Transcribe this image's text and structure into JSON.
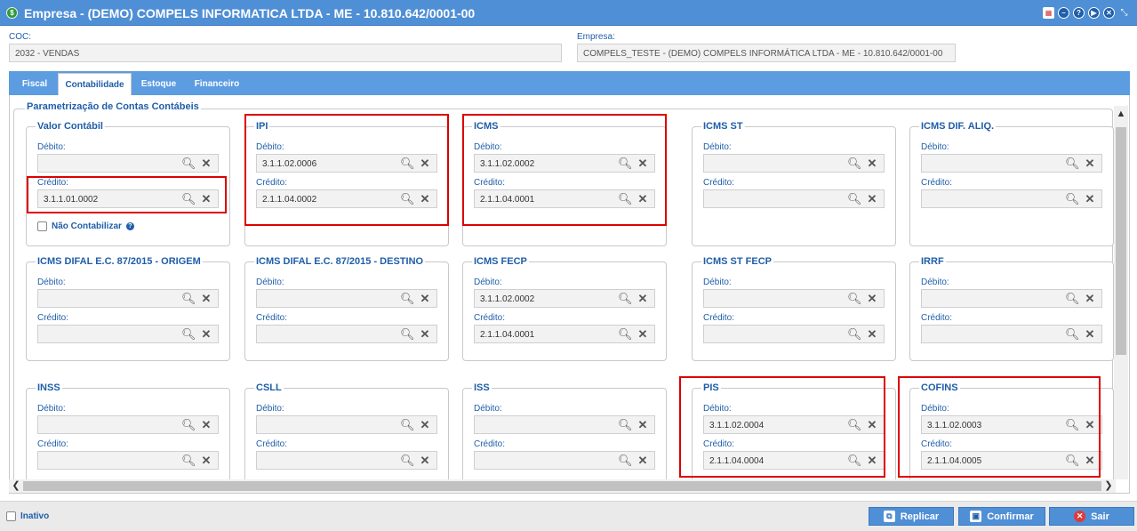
{
  "window": {
    "title": "Empresa - (DEMO) COMPELS INFORMATICA LTDA - ME - 10.810.642/0001-00",
    "icons": [
      "calendar-icon",
      "minimize-icon",
      "help-icon",
      "play-icon",
      "close-icon",
      "resize-icon"
    ]
  },
  "header": {
    "coc_label": "COC:",
    "coc_value": "2032 - VENDAS",
    "empresa_label": "Empresa:",
    "empresa_value": "COMPELS_TESTE - (DEMO) COMPELS INFORMÁTICA LTDA - ME - 10.810.642/0001-00"
  },
  "tabs": [
    {
      "label": "Fiscal"
    },
    {
      "label": "Contabilidade"
    },
    {
      "label": "Estoque"
    },
    {
      "label": "Financeiro"
    }
  ],
  "section": {
    "title": "Parametrização de Contas Contábeis",
    "debit_label": "Débito:",
    "credit_label": "Crédito:",
    "nao_contabilizar": "Não Contabilizar",
    "groups": [
      {
        "title": "Valor Contábil",
        "debito": "",
        "credito": "3.1.1.01.0002"
      },
      {
        "title": "IPI",
        "debito": "3.1.1.02.0006",
        "credito": "2.1.1.04.0002"
      },
      {
        "title": "ICMS",
        "debito": "3.1.1.02.0002",
        "credito": "2.1.1.04.0001"
      },
      {
        "title": "ICMS ST",
        "debito": "",
        "credito": ""
      },
      {
        "title": "ICMS DIF. ALIQ.",
        "debito": "",
        "credito": ""
      },
      {
        "title": "ICMS DIFAL E.C. 87/2015 - ORIGEM",
        "debito": "",
        "credito": ""
      },
      {
        "title": "ICMS DIFAL E.C. 87/2015 - DESTINO",
        "debito": "",
        "credito": ""
      },
      {
        "title": "ICMS FECP",
        "debito": "3.1.1.02.0002",
        "credito": "2.1.1.04.0001"
      },
      {
        "title": "ICMS ST FECP",
        "debito": "",
        "credito": ""
      },
      {
        "title": "IRRF",
        "debito": "",
        "credito": ""
      },
      {
        "title": "INSS",
        "debito": "",
        "credito": ""
      },
      {
        "title": "CSLL",
        "debito": "",
        "credito": ""
      },
      {
        "title": "ISS",
        "debito": "",
        "credito": ""
      },
      {
        "title": "PIS",
        "debito": "3.1.1.02.0004",
        "credito": "2.1.1.04.0004"
      },
      {
        "title": "COFINS",
        "debito": "3.1.1.02.0003",
        "credito": "2.1.1.04.0005"
      }
    ]
  },
  "footer": {
    "inativo_label": "Inativo",
    "replicar_label": "Replicar",
    "confirmar_label": "Confirmar",
    "sair_label": "Sair"
  },
  "colors": {
    "titlebar": "#4f8fd6",
    "tabstrip": "#5c9ce0",
    "label_blue": "#1f5ea8",
    "highlight": "#dd0000",
    "sair_icon": "#e03a3a"
  }
}
